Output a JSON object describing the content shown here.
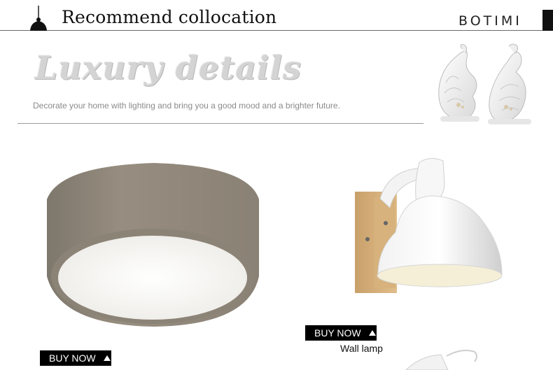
{
  "header": {
    "title": "Recommend collocation",
    "brand": "BOTIMI"
  },
  "banner": {
    "title": "Luxury details",
    "subtitle": "Decorate your home with lighting and bring you a good mood and a brighter future."
  },
  "products": [
    {
      "name": "ceiling-lamp",
      "button": "BUY NOW",
      "caption": ""
    },
    {
      "name": "wall-lamp",
      "button": "BUY NOW",
      "caption": "Wall lamp"
    }
  ],
  "icons": [
    "pendant-lamp-icon",
    "up-triangle-icon"
  ],
  "colors": {
    "button_bg": "#000000",
    "button_text": "#ffffff",
    "lamp_shade": "#8f8577"
  }
}
